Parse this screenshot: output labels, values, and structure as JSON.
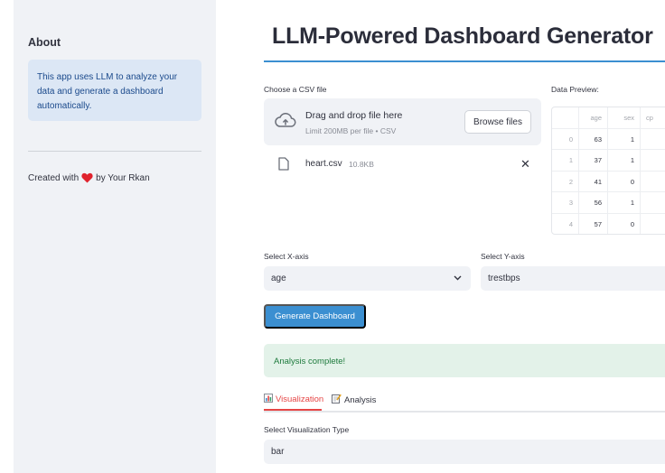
{
  "sidebar": {
    "about_heading": "About",
    "info_text": "This app uses LLM to analyze your data and generate a dashboard automatically.",
    "credit_prefix": "Created with",
    "credit_suffix": "by Your Rkan",
    "heart_icon": "heart-icon",
    "heart_color": "#e0232e"
  },
  "main": {
    "title": "LLM-Powered Dashboard Generator",
    "uploader": {
      "label": "Choose a CSV file",
      "drop_text": "Drag and drop file here",
      "limit_text": "Limit 200MB per file • CSV",
      "browse_label": "Browse files",
      "file_name": "heart.csv",
      "file_size": "10.8KB"
    },
    "preview": {
      "label": "Data Preview:",
      "columns": [
        "",
        "age",
        "sex",
        "cp"
      ],
      "rows": [
        [
          "0",
          "63",
          "1",
          ""
        ],
        [
          "1",
          "37",
          "1",
          ""
        ],
        [
          "2",
          "41",
          "0",
          ""
        ],
        [
          "3",
          "56",
          "1",
          ""
        ],
        [
          "4",
          "57",
          "0",
          ""
        ]
      ]
    },
    "x_axis": {
      "label": "Select X-axis",
      "value": "age"
    },
    "y_axis": {
      "label": "Select Y-axis",
      "value": "trestbps"
    },
    "generate_label": "Generate Dashboard",
    "status_text": "Analysis complete!",
    "tabs": [
      {
        "label": "Visualization",
        "icon": "bar-chart-icon"
      },
      {
        "label": "Analysis",
        "icon": "memo-icon"
      }
    ],
    "viz_type": {
      "label": "Select Visualization Type",
      "value": "bar"
    }
  },
  "colors": {
    "accent": "#3b8fd1",
    "tab_active": "#e64545",
    "success_bg": "#e3f2e9",
    "success_text": "#1d7a3c",
    "info_bg": "#dce7f5",
    "sidebar_bg": "#f0f2f6"
  }
}
